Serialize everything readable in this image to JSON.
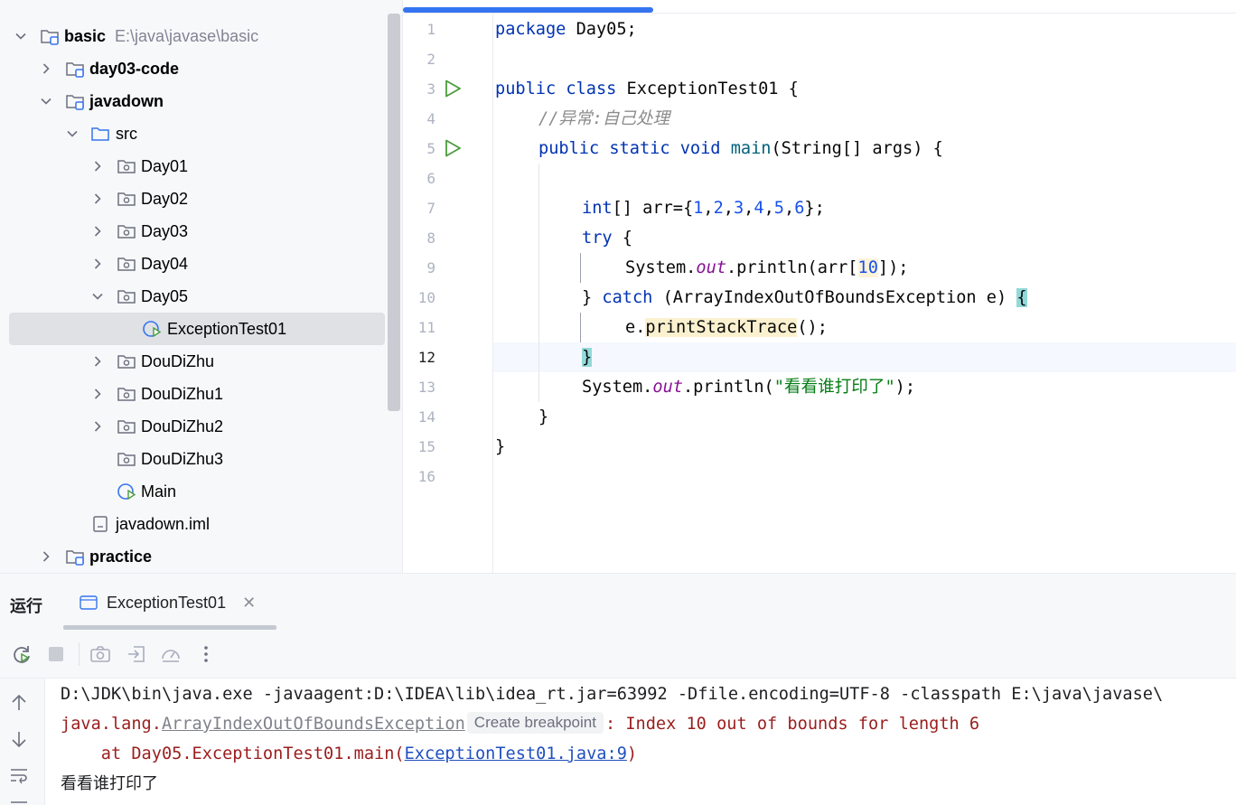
{
  "project_tree": {
    "root": {
      "name": "basic",
      "path": "E:\\java\\javase\\basic"
    },
    "items": [
      {
        "name": "day03-code"
      },
      {
        "name": "javadown"
      },
      {
        "name": "src"
      },
      {
        "name": "Day01"
      },
      {
        "name": "Day02"
      },
      {
        "name": "Day03"
      },
      {
        "name": "Day04"
      },
      {
        "name": "Day05"
      },
      {
        "name": "ExceptionTest01"
      },
      {
        "name": "DouDiZhu"
      },
      {
        "name": "DouDiZhu1"
      },
      {
        "name": "DouDiZhu2"
      },
      {
        "name": "DouDiZhu3"
      },
      {
        "name": "Main"
      },
      {
        "name": "javadown.iml"
      },
      {
        "name": "practice"
      }
    ]
  },
  "editor": {
    "current_line": 12,
    "line_numbers": [
      "1",
      "2",
      "3",
      "4",
      "5",
      "6",
      "7",
      "8",
      "9",
      "10",
      "11",
      "12",
      "13",
      "14",
      "15",
      "16"
    ],
    "code": {
      "l1_kw": "package",
      "l1_rest": " Day05;",
      "l3_kw": "public class",
      "l3_rest": " ExceptionTest01 {",
      "l4_comment": "//异常:自己处理",
      "l5_kw": "public static void",
      "l5_method": "main",
      "l5_rest": "(String[] args) {",
      "l7_kw": "int",
      "l7_a": "[] arr={",
      "l7_nums": [
        "1",
        "2",
        "3",
        "4",
        "5",
        "6"
      ],
      "l7_end": "};",
      "l8_kw": "try",
      "l8_rest": " {",
      "l9_a": "System.",
      "l9_field": "out",
      "l9_b": ".println(arr[",
      "l9_num": "10",
      "l9_c": "]);",
      "l10_a": "} ",
      "l10_kw": "catch",
      "l10_b": " (ArrayIndexOutOfBoundsException e) ",
      "l10_brace": "{",
      "l11_a": "e.",
      "l11_method": "printStackTrace",
      "l11_b": "();",
      "l12_brace": "}",
      "l13_a": "System.",
      "l13_field": "out",
      "l13_b": ".println(",
      "l13_str": "\"看看谁打印了\"",
      "l13_c": ");",
      "l14": "}",
      "l15": "}"
    }
  },
  "run_panel": {
    "title": "运行",
    "tab_label": "ExceptionTest01",
    "console": {
      "command": "D:\\JDK\\bin\\java.exe -javaagent:D:\\IDEA\\lib\\idea_rt.jar=63992 -Dfile.encoding=UTF-8 -classpath E:\\java\\javase\\",
      "exception_prefix": "java.lang.",
      "exception_class": "ArrayIndexOutOfBoundsException",
      "tooltip": "Create breakpoint",
      "exception_msg": ": Index 10 out of bounds for length 6",
      "stack_prefix": "    at Day05.ExceptionTest01.main(",
      "stack_link": "ExceptionTest01.java:9",
      "stack_suffix": ")",
      "output_line": "看看谁打印了"
    }
  },
  "colors": {
    "accent": "#3574f0",
    "keyword": "#0033b3",
    "string": "#067d17",
    "number": "#1750eb",
    "error": "#9b1d1d",
    "run_green": "#4a9c3d"
  }
}
